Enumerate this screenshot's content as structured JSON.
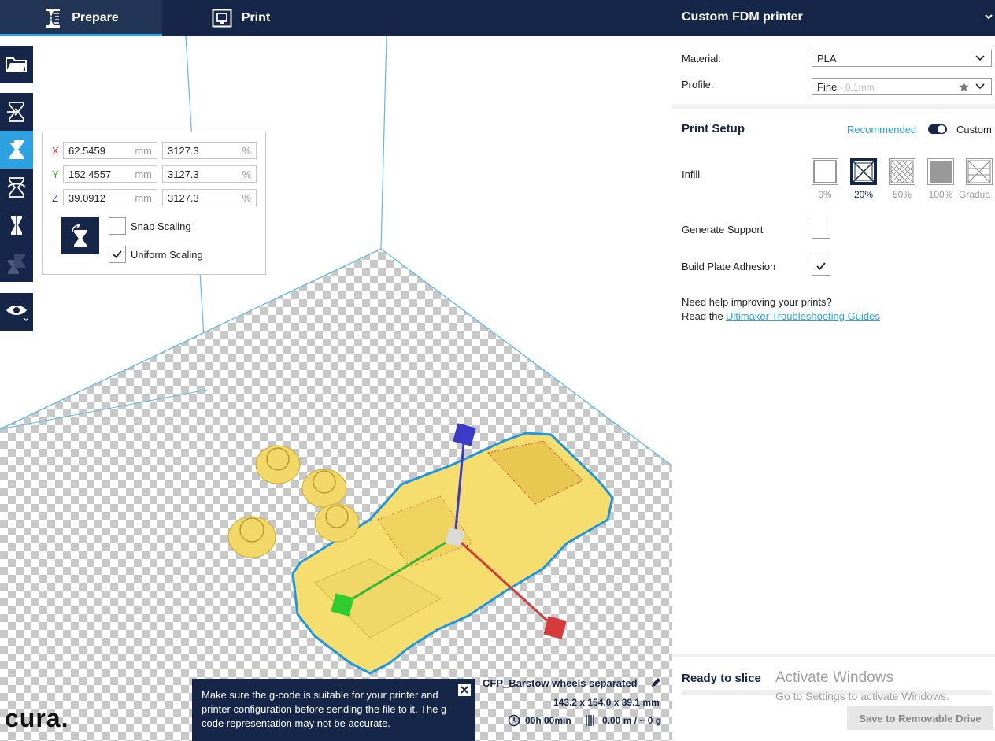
{
  "tabs": [
    {
      "label": "Prepare",
      "icon": "prepare-icon"
    },
    {
      "label": "Print",
      "icon": "print-monitor-icon"
    }
  ],
  "printer": {
    "name": "Custom FDM printer"
  },
  "toolbar": {
    "icons": [
      "open-folder-icon",
      "move-tool-icon",
      "scale-tool-icon",
      "rotate-tool-icon",
      "mirror-tool-icon",
      "per-model-settings-icon",
      "view-eye-icon"
    ]
  },
  "scale_panel": {
    "rows": [
      {
        "axis": "X",
        "mm": "62.5459",
        "mm_unit": "mm",
        "pct": "3127.3",
        "pct_unit": "%",
        "color": "#e02020"
      },
      {
        "axis": "Y",
        "mm": "152.4557",
        "mm_unit": "mm",
        "pct": "3127.3",
        "pct_unit": "%",
        "color": "#2fb52f"
      },
      {
        "axis": "Z",
        "mm": "39.0912",
        "mm_unit": "mm",
        "pct": "3127.3",
        "pct_unit": "%",
        "color": "#2b3ab8"
      }
    ],
    "snap_scaling": "Snap Scaling",
    "uniform_scaling": "Uniform Scaling",
    "snap_checked": false,
    "uniform_checked": true
  },
  "settings": {
    "material_label": "Material:",
    "material_value": "PLA",
    "profile_label": "Profile:",
    "profile_value": "Fine",
    "profile_suffix": " - 0.1mm",
    "print_setup": "Print Setup",
    "recommended": "Recommended",
    "custom": "Custom",
    "infill_label": "Infill",
    "infill_options": [
      {
        "label": "0%",
        "selected": false
      },
      {
        "label": "20%",
        "selected": true
      },
      {
        "label": "50%",
        "selected": false
      },
      {
        "label": "100%",
        "selected": false
      },
      {
        "label": "Gradua",
        "selected": false
      }
    ],
    "support_label": "Generate Support",
    "support_checked": false,
    "adhesion_label": "Build Plate Adhesion",
    "adhesion_checked": true,
    "help_line1": "Need help improving your prints?",
    "help_line2_prefix": "Read the ",
    "help_link": "Ultimaker Troubleshooting Guides"
  },
  "model_info": {
    "name": "CFP_Barstow wheels separated",
    "dimensions": "143.2 x 154.0 x 39.1 mm",
    "time": "00h 00min",
    "material_usage": "0.00 m / ~ 0 g"
  },
  "toast": {
    "message": "Make sure the g-code is suitable for your printer and printer configuration before sending the file to it. The g-code representation may not be accurate."
  },
  "slice": {
    "status": "Ready to slice",
    "button": "Save to Removable Drive"
  },
  "watermark": {
    "line1": "Activate Windows",
    "line2": "Go to Settings to activate Windows."
  },
  "logo": {
    "text": "cura."
  },
  "colors": {
    "header": "#162649",
    "accent": "#2ea1e1",
    "model_yellow": "#f5de6e",
    "checker": "#c8c8c8"
  }
}
